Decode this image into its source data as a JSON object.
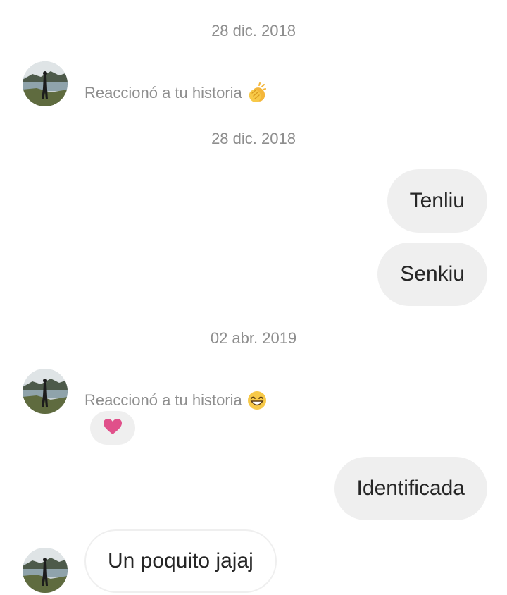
{
  "thread": {
    "dates": [
      "28 dic. 2018",
      "28 dic. 2018",
      "02 abr. 2019"
    ],
    "reactions": [
      {
        "text": "Reaccionó a tu historia",
        "emoji": "clapping-hands-icon"
      },
      {
        "text": "Reaccionó a tu historia",
        "emoji": "grinning-face-icon",
        "heart_reaction": "heart-icon"
      }
    ],
    "outgoing": [
      "Tenliu",
      "Senkiu",
      "Identificada"
    ],
    "incoming": [
      "Un poquito jajaj"
    ]
  },
  "colors": {
    "meta_text": "#8e8e8e",
    "bubble_bg": "#efefef",
    "text": "#262626",
    "heart": "#e0508a"
  }
}
